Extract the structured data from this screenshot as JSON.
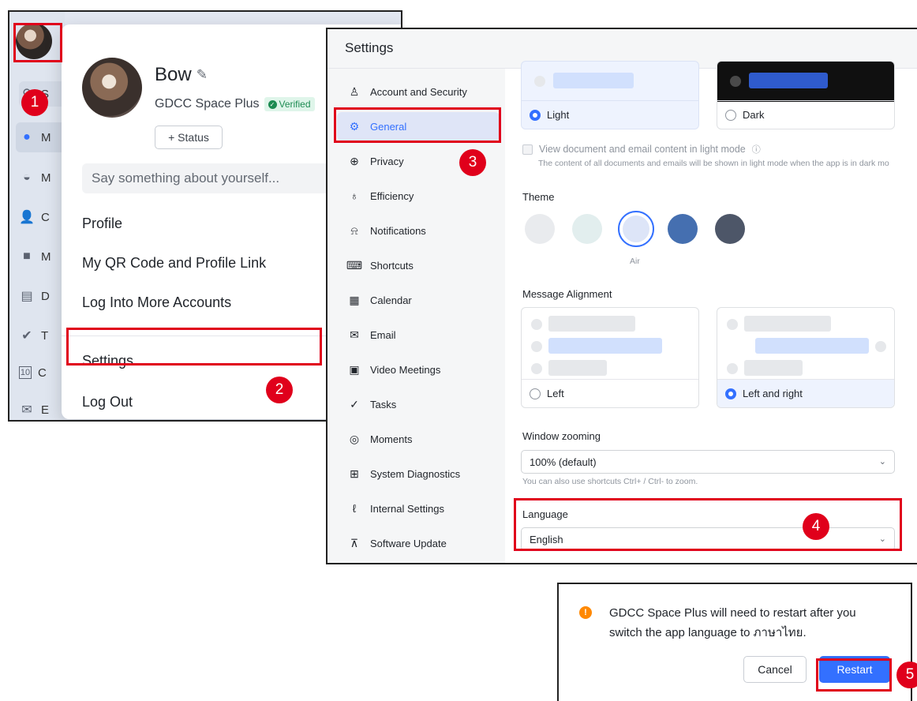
{
  "profile_menu": {
    "rail_letters": [
      "S",
      "M",
      "M",
      "C",
      "M",
      "D",
      "T",
      "C",
      "E"
    ],
    "user_name": "Bow",
    "org_name": "GDCC Space Plus",
    "verified_label": "Verified",
    "status_button": "+ Status",
    "about_placeholder": "Say something about yourself...",
    "items": [
      "Profile",
      "My QR Code and Profile Link",
      "Log Into More Accounts",
      "Settings",
      "Log Out"
    ]
  },
  "settings": {
    "title": "Settings",
    "nav": [
      {
        "label": "Account and Security",
        "icon": "user-icon"
      },
      {
        "label": "General",
        "icon": "gear-icon"
      },
      {
        "label": "Privacy",
        "icon": "shield-icon"
      },
      {
        "label": "Efficiency",
        "icon": "bulb-icon"
      },
      {
        "label": "Notifications",
        "icon": "bell-icon"
      },
      {
        "label": "Shortcuts",
        "icon": "keyboard-icon"
      },
      {
        "label": "Calendar",
        "icon": "calendar-icon"
      },
      {
        "label": "Email",
        "icon": "mail-icon"
      },
      {
        "label": "Video Meetings",
        "icon": "video-icon"
      },
      {
        "label": "Tasks",
        "icon": "check-icon"
      },
      {
        "label": "Moments",
        "icon": "moments-icon"
      },
      {
        "label": "System Diagnostics",
        "icon": "toolbox-icon"
      },
      {
        "label": "Internal Settings",
        "icon": "wrench-icon"
      },
      {
        "label": "Software Update",
        "icon": "arrow-up-circle-icon"
      }
    ],
    "active_nav": "General",
    "appearance": {
      "light": "Light",
      "dark": "Dark",
      "selected": "Light"
    },
    "light_mode_checkbox": "View document and email content in light mode",
    "light_mode_note": "The content of all documents and emails will be shown in light mode when the app is in dark mo",
    "theme_label": "Theme",
    "theme_swatches": [
      "#e9ebee",
      "#e2eeee",
      "#dde5f8",
      "#456fb0",
      "#4d5668"
    ],
    "theme_selected_name": "Air",
    "alignment_label": "Message Alignment",
    "alignment_options": {
      "left": "Left",
      "left_right": "Left and right",
      "selected": "Left and right"
    },
    "zoom_label": "Window zooming",
    "zoom_value": "100% (default)",
    "zoom_note": "You can also use shortcuts Ctrl+ / Ctrl- to zoom.",
    "language_label": "Language",
    "language_value": "English"
  },
  "dialog": {
    "message": "GDCC Space Plus will need to restart after you switch the app language to ภาษาไทย.",
    "cancel": "Cancel",
    "restart": "Restart"
  },
  "steps": [
    "1",
    "2",
    "3",
    "4",
    "5"
  ],
  "colors": {
    "accent": "#3370ff",
    "annotation": "#e0001b",
    "warning": "#ff8800",
    "verified": "#1d8b52"
  }
}
